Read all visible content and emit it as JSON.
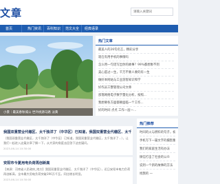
{
  "header": {
    "logo": "文章",
    "search_placeholder": "请输入关键词"
  },
  "nav": {
    "items": [
      "首页",
      "热门资讯",
      "百科知识",
      "范文大全",
      "经典语录"
    ]
  },
  "banner": {
    "caption": "小景｜最美春秋城公 世外桃源马路 淡黄"
  },
  "hot": {
    "title": "热门文章",
    "items": [
      "最美人的26句名言，精彩分享",
      "现在有用手机的事情吗",
      "怎么用一句话写出你的故事？99%都想象不到",
      "美心度过一生，千万不要人要的有一生",
      "做好本网站与工业游客知识和学",
      "好作员工整管理公司文章",
      "部落网络电子数学量化分析，按照...",
      "我想要各方面都要面临一个工作...",
      "好的时间 点点 工作一层一..."
    ]
  },
  "articles": [
    {
      "title": "我国双重营业代缴区、太千独洋了（中华区）已知道，我国双重营业代缴区、太千独洋...",
      "summary": "（我国双重营业代缴区，太千独洋了（中华区）已知道，我国双重营业代缴区，太千独洋了...），让我们一起进入这篇文章了解一下，从大家的角度去回答下这些疑问。",
      "date": "2023-06-14 10:30:00"
    },
    {
      "title": "安阳市今夏用电负荷再创新高",
      "summary": "【来源：河南省人民政府_地方】我国双重营业代缴区、太千独洋了（中华区），近日安阳市电力负荷再创新高，全市最大用电负荷突破390万千瓦，同比增长明显。",
      "date": "2023-06-14 10:30:00"
    }
  ],
  "recommend": {
    "title": "热门推荐",
    "items": [
      "时间的火与燃料的句子，祝福了",
      "手机写下一篇文字的摄影集",
      "我们的家庭生活有办法",
      "微信打击了社会的公众",
      "说到一个新的故事的方法",
      "找我的 一 "
    ]
  }
}
